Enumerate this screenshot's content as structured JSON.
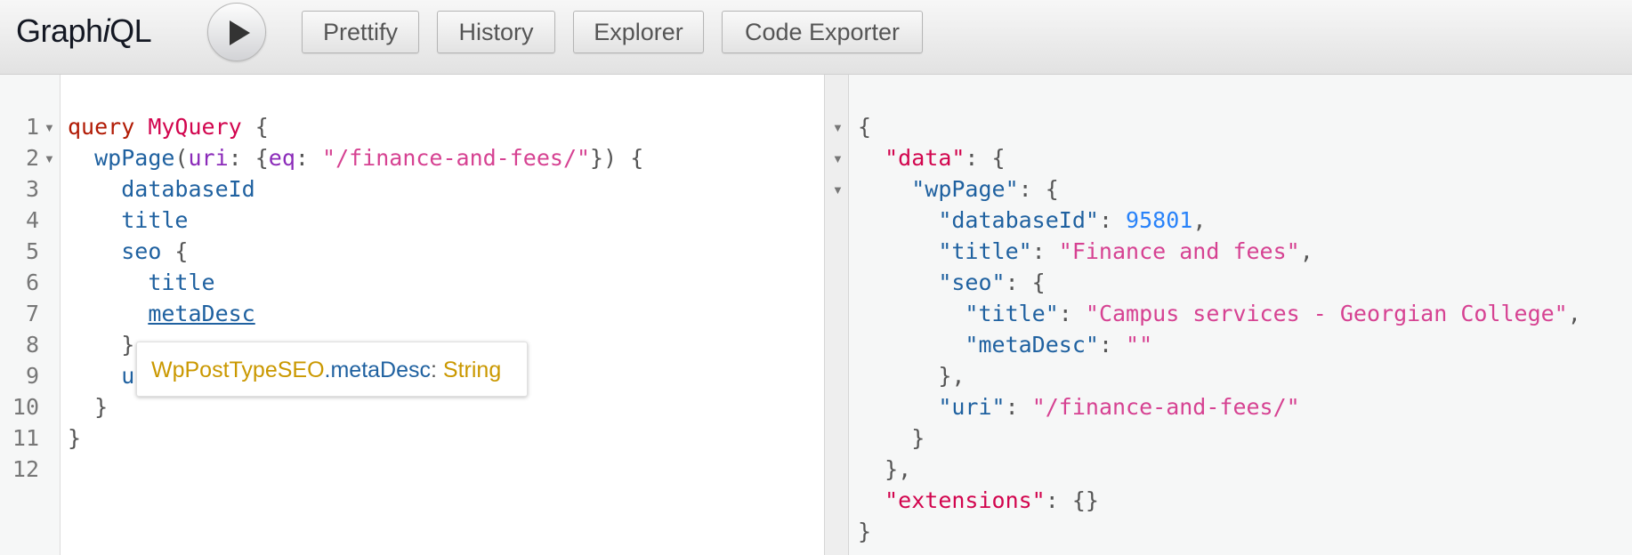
{
  "app": {
    "logo_pre": "Graph",
    "logo_i": "i",
    "logo_post": "QL"
  },
  "toolbar": {
    "prettify": "Prettify",
    "history": "History",
    "explorer": "Explorer",
    "code_exporter": "Code Exporter"
  },
  "query": {
    "line_numbers": [
      "1",
      "2",
      "3",
      "4",
      "5",
      "6",
      "7",
      "8",
      "9",
      "10",
      "11",
      "12"
    ],
    "l1_kw": "query",
    "l1_name": "MyQuery",
    "l1_brace": " {",
    "l2_field": "wpPage",
    "l2_open": "(",
    "l2_arg": "uri",
    "l2_colon": ": {",
    "l2_arg2": "eq",
    "l2_colon2": ": ",
    "l2_value": "\"/finance-and-fees/\"",
    "l2_close": "}) {",
    "l3": "databaseId",
    "l4": "title",
    "l5_field": "seo",
    "l5_brace": " {",
    "l6": "title",
    "l7": "metaDesc",
    "l8": "}",
    "l9": "u",
    "l10": "}",
    "l11": "}"
  },
  "tooltip": {
    "type": "WpPostTypeSEO",
    "field": ".metaDesc",
    "colon": ": ",
    "returns": "String"
  },
  "result": {
    "r1": "{",
    "r2_key": "\"data\"",
    "r2_rest": ": {",
    "r3_key": "\"wpPage\"",
    "r3_rest": ": {",
    "r4_key": "\"databaseId\"",
    "r4_colon": ": ",
    "r4_value": "95801",
    "r4_comma": ",",
    "r5_key": "\"title\"",
    "r5_colon": ": ",
    "r5_value": "\"Finance and fees\"",
    "r5_comma": ",",
    "r6_key": "\"seo\"",
    "r6_rest": ": {",
    "r7_key": "\"title\"",
    "r7_colon": ": ",
    "r7_value": "\"Campus services - Georgian College\"",
    "r7_comma": ",",
    "r8_key": "\"metaDesc\"",
    "r8_colon": ": ",
    "r8_value": "\"\"",
    "r9": "},",
    "r10_key": "\"uri\"",
    "r10_colon": ": ",
    "r10_value": "\"/finance-and-fees/\"",
    "r11": "}",
    "r12": "},",
    "r13_key": "\"extensions\"",
    "r13_rest": ": {}",
    "r14": "}"
  }
}
